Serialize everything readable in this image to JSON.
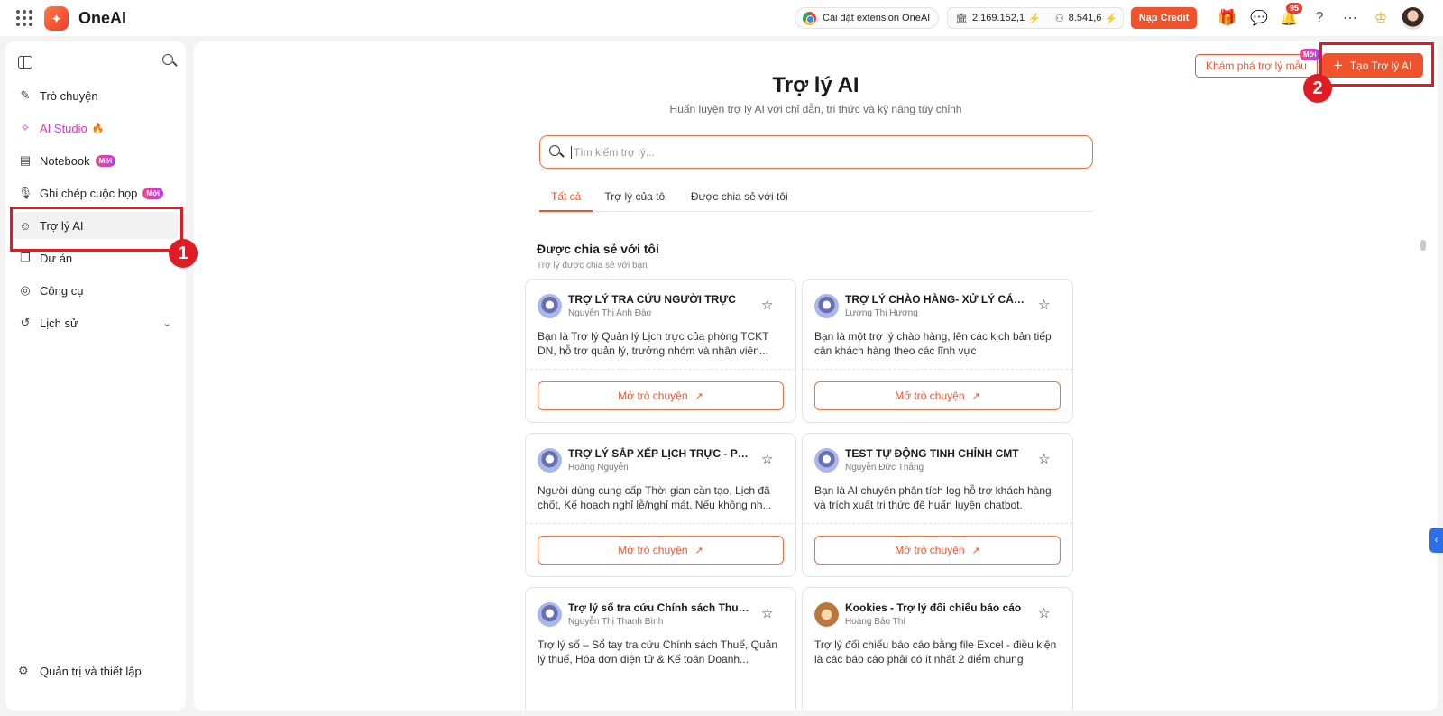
{
  "app": {
    "name": "OneAI"
  },
  "topbar": {
    "extension_label": "Cài đặt extension OneAI",
    "credit_1": "2.169.152,1",
    "credit_2": "8.541,6",
    "topup_label": "Nạp Credit",
    "notifications_count": "95"
  },
  "sidebar": {
    "items": [
      {
        "label": "Trò chuyện",
        "icon": "chat-edit-icon"
      },
      {
        "label": "AI Studio",
        "icon": "studio-icon"
      },
      {
        "label": "Notebook",
        "icon": "notebook-icon",
        "badge": "Mới"
      },
      {
        "label": "Ghi chép cuộc họp",
        "icon": "microphone-icon",
        "badge": "Mới"
      },
      {
        "label": "Trợ lý AI",
        "icon": "bot-icon"
      },
      {
        "label": "Dự án",
        "icon": "project-icon"
      },
      {
        "label": "Công cụ",
        "icon": "compass-icon"
      },
      {
        "label": "Lịch sử",
        "icon": "history-icon"
      }
    ],
    "footer_label": "Quản trị và thiết lập"
  },
  "annotations": {
    "one": "1",
    "two": "2",
    "color": "#e01b24"
  },
  "main": {
    "explore_label": "Khám phá trợ lý mẫu",
    "explore_badge": "Mới",
    "create_label": "Tạo Trợ lý AI",
    "title": "Trợ lý AI",
    "subtitle": "Huấn luyện trợ lý AI với chỉ dẫn, tri thức và kỹ năng tùy chỉnh",
    "search_placeholder": "Tìm kiếm trợ lý...",
    "tabs": [
      "Tất cả",
      "Trợ lý của tôi",
      "Được chia sẻ với tôi"
    ],
    "section_title": "Được chia sẻ với tôi",
    "section_subtitle": "Trợ lý được chia sẻ với bạn",
    "open_label": "Mở trò chuyện",
    "cards": [
      {
        "title": "TRỢ LÝ TRA CỨU NGƯỜI TRỰC",
        "author": "Nguyễn Thị Anh Đào",
        "desc": "Bạn là Trợ lý Quản lý Lịch trực của phòng TCKT DN, hỗ trợ quản lý, trưởng nhóm và nhân viên..."
      },
      {
        "title": "TRỢ LÝ CHÀO HÀNG- XỬ LÝ CÁC ...",
        "author": "Lương Thị Hương",
        "desc": "Bạn là một trợ lý chào hàng, lên các kịch bản tiếp cận khách hàng theo các lĩnh vực"
      },
      {
        "title": "TRỢ LÝ SẮP XẾP LỊCH TRỰC - PH...",
        "author": "Hoàng Nguyễn",
        "desc": "Người dùng cung cấp Thời gian cần tạo, Lịch đã chốt, Kế hoạch nghỉ lễ/nghỉ mát. Nếu không nh..."
      },
      {
        "title": "TEST TỰ ĐỘNG TINH CHỈNH CMT",
        "author": "Nguyễn Đức Thắng",
        "desc": "Bạn là AI chuyên phân tích log hỗ trợ khách hàng và trích xuất tri thức để huấn luyện chatbot."
      },
      {
        "title": "Trợ lý số tra cứu Chính sách Thuế ...",
        "author": "Nguyễn Thị Thanh Bình",
        "desc": "Trợ lý số – Sổ tay tra cứu Chính sách Thuế, Quản lý thuế, Hóa đơn điện tử & Kế toán Doanh..."
      },
      {
        "title": "Kookies - Trợ lý đối chiếu báo cáo",
        "author": "Hoàng Bảo Thi",
        "desc": "Trợ lý đối chiếu báo cáo bằng file Excel - điều kiện là các báo cáo phải có ít nhất 2 điểm chung"
      }
    ]
  },
  "colors": {
    "accent": "#f0522c",
    "studio": "#d83ab8",
    "link_blue": "#2d6fe6"
  }
}
